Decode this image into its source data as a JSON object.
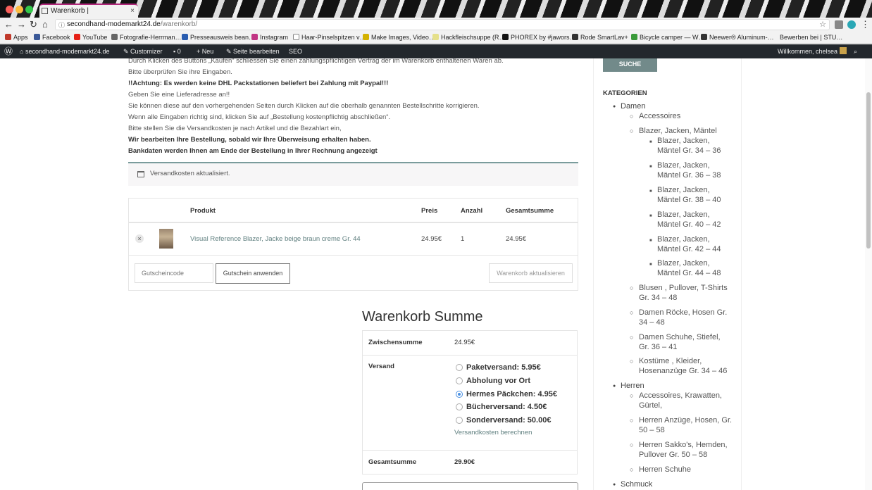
{
  "browser": {
    "tab_title": "Warenkorb |",
    "tab_close": "×",
    "url_host": "secondhand-modemarkt24.de",
    "url_path": "/warenkorb/",
    "bookmarks": [
      "Apps",
      "Facebook",
      "YouTube",
      "Fotografie-Herrman…",
      "Presseausweis bean…",
      "Instagram",
      "Haar-Pinselspitzen v…",
      "Make Images, Video…",
      "Hackfleischsuppe (R…",
      "PHOREX by #jawors…",
      "Rode SmartLav+",
      "Bicycle camper — W…",
      "Neewer® Aluminum-…",
      "Bewerben bei | STU…"
    ]
  },
  "adminbar": {
    "site": "secondhand-modemarkt24.de",
    "customizer": "Customizer",
    "comments": "0",
    "new": "Neu",
    "edit": "Seite bearbeiten",
    "seo": "SEO",
    "welcome": "Willkommen, chelsea"
  },
  "messages": [
    "Durch Klicken des Buttons „Kaufen“ schliessen Sie einen zahlungspflichtigen Vertrag der im Warenkorb enthaltenen Waren ab.",
    "Bitte überprüfen Sie ihre Eingaben.",
    "!!Achtung: Es werden keine DHL Packstationen beliefert bei Zahlung mit Paypal!!!",
    "Geben Sie eine Lieferadresse an!!",
    "Sie können diese auf den vorhergehenden Seiten durch Klicken auf die oberhalb genannten Bestellschritte korrigieren.",
    "Wenn alle Eingaben richtig sind, klicken Sie auf „Bestellung kostenpflichtig abschließen“.",
    "Bitte stellen Sie die Versandkosten je nach Artikel und die Bezahlart ein,",
    "Wir bearbeiten Ihre Bestellung, sobald wir Ihre Überweisung erhalten haben.",
    "Bankdaten werden Ihnen am Ende der Bestellung in Ihrer Rechnung angezeigt"
  ],
  "notice": "Versandkosten aktualisiert.",
  "cart": {
    "headers": {
      "product": "Produkt",
      "price": "Preis",
      "qty": "Anzahl",
      "total": "Gesamtsumme"
    },
    "item": {
      "name": "Visual Reference Blazer, Jacke beige braun creme Gr. 44",
      "price": "24.95€",
      "qty": "1",
      "total": "24.95€",
      "remove": "×"
    },
    "coupon_placeholder": "Gutscheincode",
    "apply_coupon": "Gutschein anwenden",
    "update_cart": "Warenkorb aktualisieren"
  },
  "totals": {
    "title": "Warenkorb Summe",
    "subtotal_label": "Zwischensumme",
    "subtotal": "24.95€",
    "shipping_label": "Versand",
    "shipping_options": [
      "Paketversand: 5.95€",
      "Abholung vor Ort",
      "Hermes Päckchen: 4.95€",
      "Bücherversand: 4.50€",
      "Sonderversand: 50.00€"
    ],
    "selected_shipping_index": 2,
    "calc_shipping": "Versandkosten berechnen",
    "total_label": "Gesamtsumme",
    "total": "29.90€"
  },
  "sidebar": {
    "search_button": "SUCHE",
    "categories_title": "KATEGORIEN",
    "categories": [
      "Damen",
      "Accessoires",
      "Blazer, Jacken, Mäntel",
      "Blazer, Jacken, Mäntel Gr. 34 – 36",
      "Blazer, Jacken, Mäntel Gr. 36 – 38",
      "Blazer, Jacken, Mäntel Gr. 38 – 40",
      "Blazer, Jacken, Mäntel Gr. 40 – 42",
      "Blazer, Jacken, Mäntel Gr. 42 – 44",
      "Blazer, Jacken, Mäntel Gr. 44 – 48",
      "Blusen , Pullover, T-Shirts Gr. 34 – 48",
      "Damen Röcke, Hosen Gr. 34 – 48",
      "Damen Schuhe, Stiefel, Gr. 36 – 41",
      "Kostüme , Kleider, Hosenanzüge Gr. 34 – 46",
      "Herren",
      "Accessoires, Krawatten, Gürtel,",
      "Herren Anzüge, Hosen, Gr. 50 – 58",
      "Herren Sakko's, Hemden, Pullover Gr. 50 – 58",
      "Herren Schuhe",
      "Schmuck"
    ]
  }
}
